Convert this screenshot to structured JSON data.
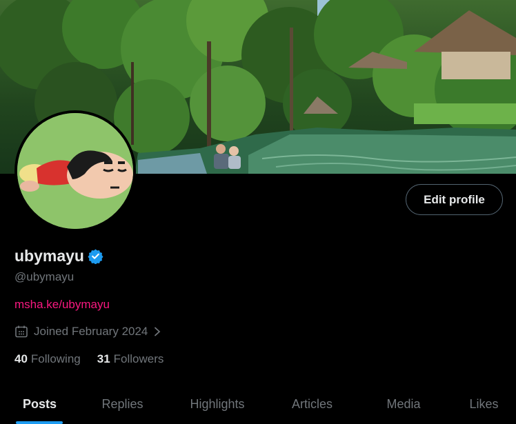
{
  "profile": {
    "display_name": "ubymayu",
    "handle": "@ubymayu",
    "website": "msha.ke/ubymayu",
    "joined": "Joined February 2024",
    "following_count": "40",
    "following_label": "Following",
    "followers_count": "31",
    "followers_label": "Followers",
    "edit_label": "Edit profile"
  },
  "tabs": [
    {
      "label": "Posts",
      "active": true
    },
    {
      "label": "Replies",
      "active": false
    },
    {
      "label": "Highlights",
      "active": false
    },
    {
      "label": "Articles",
      "active": false
    },
    {
      "label": "Media",
      "active": false
    },
    {
      "label": "Likes",
      "active": false
    }
  ],
  "colors": {
    "accent": "#1d9bf0",
    "link": "#f91880",
    "muted": "#71767b",
    "verified": "#1d9bf0"
  },
  "icons": [
    "verified-badge-icon",
    "calendar-icon",
    "chevron-right-icon"
  ]
}
